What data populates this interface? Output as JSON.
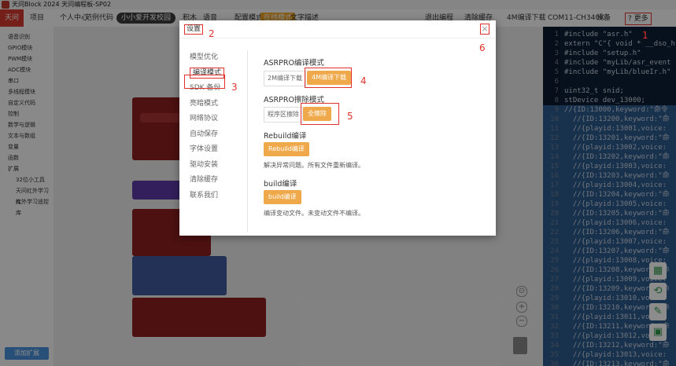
{
  "window": {
    "title": "天问Block 2024 天问编程板-SP02"
  },
  "toolbar": {
    "brand": "天问",
    "items": [
      "项目",
      "个人中心",
      "范例代码",
      "小小爱开发校园",
      "积木",
      "语音",
      "配置模式",
      "在线模式",
      "文字描述"
    ],
    "right": [
      "退出编程",
      "清除缓存",
      "4M编译下载",
      "COM11-CH340K",
      "设备",
      "更多"
    ]
  },
  "sidebar": {
    "items": [
      "语音识别",
      "GPIO模块",
      "PWM模块",
      "ADC模块",
      "串口",
      "多线程模块",
      "自定义代码",
      "控制",
      "数学与逻辑",
      "文本与数组",
      "变量",
      "函数",
      "扩展",
      "32位小工具",
      "天问红外学习库",
      "红外学习遥控库"
    ],
    "add_button": "添加扩展"
  },
  "code": {
    "lines": [
      {
        "n": "1",
        "t": "#include \"asr.h\""
      },
      {
        "n": "2",
        "t": "extern \"C\"{ void * __dso_h"
      },
      {
        "n": "3",
        "t": "#include \"setup.h\""
      },
      {
        "n": "4",
        "t": "#include \"myLib/asr_event"
      },
      {
        "n": "5",
        "t": "#include \"myLib/blueIr.h\""
      },
      {
        "n": "6",
        "t": ""
      },
      {
        "n": "7",
        "t": "uint32_t snid;"
      },
      {
        "n": "8",
        "t": "stDevice dev_13000;"
      },
      {
        "n": "9",
        "t": "//{ID:13000,keyword:\"命令"
      },
      {
        "n": "10",
        "t": "  //{ID:13200,keyword:\"命"
      },
      {
        "n": "11",
        "t": "  //{playid:13001,voice:"
      },
      {
        "n": "12",
        "t": "  //{ID:13201,keyword:\"命"
      },
      {
        "n": "13",
        "t": "  //{playid:13002,voice:"
      },
      {
        "n": "14",
        "t": "  //{ID:13202,keyword:\"命"
      },
      {
        "n": "15",
        "t": "  //{playid:13003,voice:"
      },
      {
        "n": "16",
        "t": "  //{ID:13203,keyword:\"命"
      },
      {
        "n": "17",
        "t": "  //{playid:13004,voice:"
      },
      {
        "n": "18",
        "t": "  //{ID:13204,keyword:\"命"
      },
      {
        "n": "19",
        "t": "  //{playid:13005,voice:"
      },
      {
        "n": "20",
        "t": "  //{ID:13205,keyword:\"命"
      },
      {
        "n": "21",
        "t": "  //{playid:13006,voice:"
      },
      {
        "n": "22",
        "t": "  //{ID:13206,keyword:\"命"
      },
      {
        "n": "23",
        "t": "  //{playid:13007,voice:"
      },
      {
        "n": "24",
        "t": "  //{ID:13207,keyword:\"命"
      },
      {
        "n": "25",
        "t": "  //{playid:13008,voice:"
      },
      {
        "n": "26",
        "t": "  //{ID:13208,keyword:\"命"
      },
      {
        "n": "27",
        "t": "  //{playid:13009,voice:"
      },
      {
        "n": "28",
        "t": "  //{ID:13209,keyword:\"命"
      },
      {
        "n": "29",
        "t": "  //{playid:13010,voice:"
      },
      {
        "n": "30",
        "t": "  //{ID:13210,keyword:\"命"
      },
      {
        "n": "31",
        "t": "  //{playid:13011,voice:"
      },
      {
        "n": "32",
        "t": "  //{ID:13211,keyword:\"命"
      },
      {
        "n": "33",
        "t": "  //{playid:13012,voice:"
      },
      {
        "n": "34",
        "t": "  //{ID:13212,keyword:\"命"
      },
      {
        "n": "35",
        "t": "  //{playid:13013,voice:"
      },
      {
        "n": "36",
        "t": "  //{ID:13213,keyword:\"命"
      },
      {
        "n": "37",
        "t": "  //{playid:13014,voice:"
      }
    ]
  },
  "dialog": {
    "title": "设置",
    "close": "×",
    "menu": [
      "模型优化",
      "编译模式",
      "SDK 备份",
      "亮暗模式",
      "网络协议",
      "自动保存",
      "字体设置",
      "驱动安装",
      "清除缓存",
      "联系我们"
    ],
    "compile_mode": {
      "title": "ASRPRO编译模式",
      "opt_2m": "2M编译下载",
      "opt_4m": "4M编译下载"
    },
    "erase_mode": {
      "title": "ASRPRO擦除模式",
      "opt_partial": "程序区擦除",
      "opt_full": "全擦除"
    },
    "rebuild": {
      "title": "Rebuild编译",
      "button": "Rebuild编译",
      "hint": "解决异常问题。所有文件重新编译。"
    },
    "build": {
      "title": "build编译",
      "button": "build编译",
      "hint": "编译变动文件。未变动文件不编译。"
    }
  },
  "annotations": [
    "1",
    "2",
    "3",
    "4",
    "5",
    "6"
  ],
  "colors": {
    "accent_orange": "#f0a94a",
    "highlight_red": "#e0322b",
    "code_bg": "#0c2036"
  }
}
